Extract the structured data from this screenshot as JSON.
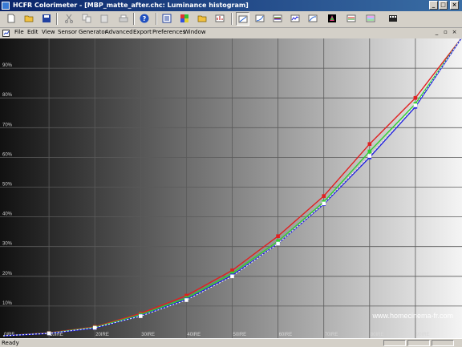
{
  "window": {
    "title": "HCFR Colorimeter - [MBP_matte_after.chc: Luminance histogram]"
  },
  "window_controls": {
    "minimize": "_",
    "maximize": "□",
    "close": "×"
  },
  "mdi_controls": {
    "minimize": "_",
    "restore": "▫",
    "close": "×"
  },
  "menu": [
    "File",
    "Edit",
    "View",
    "Sensor",
    "Generator",
    "Advanced",
    "Export",
    "Preferences",
    "Window"
  ],
  "toolbar": [
    "new-icon",
    "open-icon",
    "save-icon",
    "cut-icon",
    "copy-icon",
    "paste-icon",
    "print-icon",
    "help-icon",
    "measures-view-icon",
    "color-palette-icon",
    "open-folder-icon",
    "settings-icon",
    "luminance-view-icon",
    "gamma-view-icon",
    "rgb-levels-view-icon",
    "color-temp-view-icon",
    "cie-chart-view-icon",
    "near-black-view-icon",
    "near-white-view-icon",
    "saturation-view-icon"
  ],
  "status": {
    "text": "Ready"
  },
  "colors": {
    "red": "#e02020",
    "green": "#30d030",
    "blue": "#2020e0",
    "white_marker": "#ffffff"
  },
  "chart_data": {
    "type": "line",
    "title": "",
    "watermark": "www.homecinema-fr.com",
    "x": [
      0,
      10,
      20,
      30,
      40,
      50,
      60,
      70,
      80,
      90,
      100
    ],
    "x_ticks": [
      "0IRE",
      "10IRE",
      "20IRE",
      "30IRE",
      "40IRE",
      "50IRE",
      "60IRE",
      "70IRE",
      "80IRE",
      "90IRE"
    ],
    "y_ticks": [
      "10%",
      "20%",
      "30%",
      "40%",
      "50%",
      "60%",
      "70%",
      "80%",
      "90%"
    ],
    "ylim": [
      0,
      100
    ],
    "xlim": [
      0,
      100
    ],
    "grid": true,
    "series": [
      {
        "name": "",
        "color": "red",
        "values": [
          0,
          1.0,
          3.0,
          7.5,
          13.5,
          22.0,
          33.5,
          47.0,
          64.5,
          80.0,
          100
        ]
      },
      {
        "name": "",
        "color": "green",
        "values": [
          0,
          0.9,
          2.8,
          7.1,
          12.7,
          21.0,
          31.8,
          45.0,
          62.0,
          78.0,
          100
        ]
      },
      {
        "name": "",
        "color": "blue",
        "values": [
          0,
          0.8,
          2.6,
          6.7,
          12.2,
          20.3,
          31.0,
          44.3,
          60.0,
          77.0,
          100
        ]
      },
      {
        "name": "",
        "color": "white",
        "values": [
          0,
          0.8,
          2.7,
          6.6,
          12.0,
          20.0,
          31.0,
          44.5,
          60.5,
          77.5,
          100
        ]
      }
    ]
  }
}
